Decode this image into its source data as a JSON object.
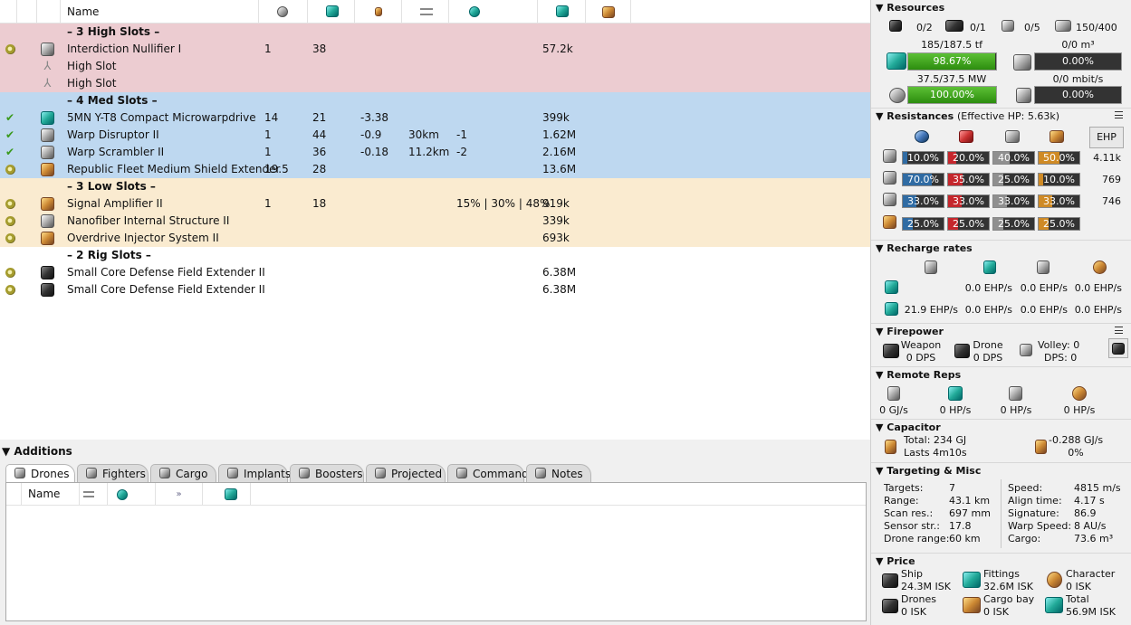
{
  "fitting": {
    "columns": {
      "name": "Name"
    },
    "header_icons": [
      "cpu-icon",
      "powergrid-icon",
      "capacitor-icon",
      "optimal-range-icon",
      "falloff-icon",
      "price-icon",
      "cargo-icon"
    ],
    "rows": [
      {
        "type": "header",
        "label": "– 3 High Slots –",
        "bg": "#ecccd1"
      },
      {
        "type": "module",
        "state": "offline",
        "name": "Interdiction Nullifier I",
        "cpu": "1",
        "pg": "38",
        "cap": "",
        "optimal": "",
        "falloff": "",
        "extra": "",
        "price": "57.2k",
        "bg": "#ecccd1",
        "icon": "ic-silver"
      },
      {
        "type": "empty",
        "name": "High Slot",
        "bg": "#ecccd1"
      },
      {
        "type": "empty",
        "name": "High Slot",
        "bg": "#ecccd1"
      },
      {
        "type": "header",
        "label": "– 4 Med Slots –",
        "bg": "#bed8f0"
      },
      {
        "type": "module",
        "state": "active",
        "name": "5MN Y-T8 Compact Microwarpdrive",
        "cpu": "14",
        "pg": "21",
        "cap": "-3.38",
        "optimal": "",
        "falloff": "",
        "extra": "",
        "price": "399k",
        "bg": "#bed8f0",
        "icon": "ic-teal"
      },
      {
        "type": "module",
        "state": "active",
        "name": "Warp Disruptor II",
        "cpu": "1",
        "pg": "44",
        "cap": "-0.9",
        "optimal": "30km",
        "falloff": "-1",
        "extra": "",
        "price": "1.62M",
        "bg": "#bed8f0",
        "icon": "ic-silver"
      },
      {
        "type": "module",
        "state": "active",
        "name": "Warp Scrambler II",
        "cpu": "1",
        "pg": "36",
        "cap": "-0.18",
        "optimal": "11.2km",
        "falloff": "-2",
        "extra": "",
        "price": "2.16M",
        "bg": "#bed8f0",
        "icon": "ic-silver"
      },
      {
        "type": "module",
        "state": "offline",
        "name": "Republic Fleet Medium Shield Extender",
        "cpu": "19.5",
        "pg": "28",
        "cap": "",
        "optimal": "",
        "falloff": "",
        "extra": "",
        "price": "13.6M",
        "bg": "#bed8f0",
        "icon": "ic-gold"
      },
      {
        "type": "header",
        "label": "– 3 Low Slots –",
        "bg": "#faebd0"
      },
      {
        "type": "module",
        "state": "offline",
        "name": "Signal Amplifier II",
        "cpu": "1",
        "pg": "18",
        "cap": "",
        "optimal": "",
        "falloff": "",
        "extra": "15% | 30% | 48%",
        "price": "919k",
        "bg": "#faebd0",
        "icon": "ic-gold"
      },
      {
        "type": "module",
        "state": "offline",
        "name": "Nanofiber Internal Structure II",
        "cpu": "",
        "pg": "",
        "cap": "",
        "optimal": "",
        "falloff": "",
        "extra": "",
        "price": "339k",
        "bg": "#faebd0",
        "icon": "ic-silver"
      },
      {
        "type": "module",
        "state": "offline",
        "name": "Overdrive Injector System II",
        "cpu": "",
        "pg": "",
        "cap": "",
        "optimal": "",
        "falloff": "",
        "extra": "",
        "price": "693k",
        "bg": "#faebd0",
        "icon": "ic-gold"
      },
      {
        "type": "header",
        "label": "– 2 Rig Slots –",
        "bg": "#ffffff"
      },
      {
        "type": "module",
        "state": "offline",
        "name": "Small Core Defense Field Extender II",
        "cpu": "",
        "pg": "",
        "cap": "",
        "optimal": "",
        "falloff": "",
        "extra": "",
        "price": "6.38M",
        "bg": "#ffffff",
        "icon": "ic-dark"
      },
      {
        "type": "module",
        "state": "offline",
        "name": "Small Core Defense Field Extender II",
        "cpu": "",
        "pg": "",
        "cap": "",
        "optimal": "",
        "falloff": "",
        "extra": "",
        "price": "6.38M",
        "bg": "#ffffff",
        "icon": "ic-dark"
      }
    ]
  },
  "additions": {
    "title": "Additions",
    "tabs": [
      {
        "label": "Drones",
        "icon": "drone-icon",
        "active": true
      },
      {
        "label": "Fighters",
        "icon": "fighter-icon",
        "active": false
      },
      {
        "label": "Cargo",
        "icon": "cargo-icon",
        "active": false
      },
      {
        "label": "Implants",
        "icon": "implant-icon",
        "active": false
      },
      {
        "label": "Boosters",
        "icon": "booster-icon",
        "active": false
      },
      {
        "label": "Projected",
        "icon": "projected-icon",
        "active": false
      },
      {
        "label": "Command",
        "icon": "command-icon",
        "active": false
      },
      {
        "label": "Notes",
        "icon": "notes-icon",
        "active": false
      }
    ],
    "columns": {
      "name": "Name"
    }
  },
  "stats": {
    "resources": {
      "title": "Resources",
      "turrets": "0/2",
      "launchers": "0/1",
      "drones": "0/5",
      "calibration": "150/400",
      "cpu_label": "185/187.5 tf",
      "cpu_pct": "98.67%",
      "cpu_fill": 98.67,
      "pg_label": "37.5/37.5 MW",
      "pg_pct": "100.00%",
      "pg_fill": 100,
      "dronebay_label": "0/0 m³",
      "dronebay_pct": "0.00%",
      "bandwidth_label": "0/0 mbit/s",
      "bandwidth_pct": "0.00%"
    },
    "resistances": {
      "title": "Resistances",
      "sub": "(Effective HP: 5.63k)",
      "ehp_button": "EHP",
      "rows": [
        {
          "vals": [
            "10.0%",
            "20.0%",
            "40.0%",
            "50.0%"
          ],
          "fills": [
            10,
            20,
            40,
            50
          ],
          "hp": "4.11k"
        },
        {
          "vals": [
            "70.0%",
            "35.0%",
            "25.0%",
            "10.0%"
          ],
          "fills": [
            70,
            35,
            25,
            10
          ],
          "hp": "769"
        },
        {
          "vals": [
            "33.0%",
            "33.0%",
            "33.0%",
            "33.0%"
          ],
          "fills": [
            33,
            33,
            33,
            33
          ],
          "hp": "746"
        },
        {
          "vals": [
            "25.0%",
            "25.0%",
            "25.0%",
            "25.0%"
          ],
          "fills": [
            25,
            25,
            25,
            25
          ],
          "hp": ""
        }
      ]
    },
    "recharge": {
      "title": "Recharge rates",
      "row1": [
        "",
        "0.0 EHP/s",
        "0.0 EHP/s",
        "0.0 EHP/s"
      ],
      "row2": [
        "21.9 EHP/s",
        "0.0 EHP/s",
        "0.0 EHP/s",
        "0.0 EHP/s"
      ]
    },
    "firepower": {
      "title": "Firepower",
      "weapon_label": "Weapon",
      "weapon_dps": "0 DPS",
      "drone_label": "Drone",
      "drone_dps": "0 DPS",
      "volley": "Volley: 0",
      "dps": "DPS: 0"
    },
    "remote_reps": {
      "title": "Remote Reps",
      "vals": [
        "0 GJ/s",
        "0 HP/s",
        "0 HP/s",
        "0 HP/s"
      ]
    },
    "capacitor": {
      "title": "Capacitor",
      "total": "Total: 234 GJ",
      "lasts": "Lasts 4m10s",
      "rate": "-0.288 GJ/s",
      "pct": "0%"
    },
    "targeting": {
      "title": "Targeting & Misc",
      "left": [
        {
          "k": "Targets:",
          "v": "7"
        },
        {
          "k": "Range:",
          "v": "43.1 km"
        },
        {
          "k": "Scan res.:",
          "v": "697 mm"
        },
        {
          "k": "Sensor str.:",
          "v": "17.8"
        },
        {
          "k": "Drone range:",
          "v": "60 km"
        }
      ],
      "right": [
        {
          "k": "Speed:",
          "v": "4815 m/s"
        },
        {
          "k": "Align time:",
          "v": "4.17 s"
        },
        {
          "k": "Signature:",
          "v": "86.9"
        },
        {
          "k": "Warp Speed:",
          "v": "8 AU/s"
        },
        {
          "k": "Cargo:",
          "v": "73.6 m³"
        }
      ]
    },
    "price": {
      "title": "Price",
      "ship_label": "Ship",
      "ship": "24.3M ISK",
      "fittings_label": "Fittings",
      "fittings": "32.6M ISK",
      "character_label": "Character",
      "character": "0 ISK",
      "drones_label": "Drones",
      "drones": "0 ISK",
      "cargo_label": "Cargo bay",
      "cargo": "0 ISK",
      "total_label": "Total",
      "total": "56.9M ISK"
    }
  }
}
